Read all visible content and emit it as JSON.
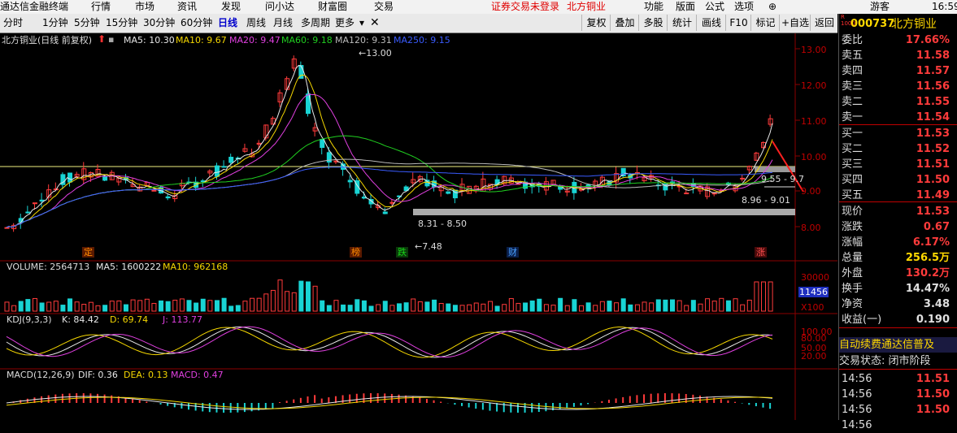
{
  "menu": {
    "app": "通达信金融终端",
    "items": [
      "行情",
      "市场",
      "资讯",
      "发现",
      "问小达",
      "财富圈",
      "交易"
    ],
    "notice": [
      "证券交易未登录",
      "北方铜业"
    ],
    "right": [
      "功能",
      "版面",
      "公式",
      "选项"
    ],
    "user": "游客",
    "time": "16:59"
  },
  "periods": [
    "分时",
    "1分钟",
    "5分钟",
    "15分钟",
    "30分钟",
    "60分钟",
    "日线",
    "周线",
    "月线",
    "多周期",
    "更多"
  ],
  "active_period": "日线",
  "tools": [
    "复权",
    "叠加",
    "多股",
    "统计",
    "画线",
    "F10",
    "标记",
    "+自选",
    "返回"
  ],
  "price_panel": {
    "title": "北方铜业(日线 前复权)",
    "ma": [
      {
        "label": "MA5: 10.30",
        "color": "#e8e8e8"
      },
      {
        "label": "MA10: 9.67",
        "color": "#f5d700"
      },
      {
        "label": "MA20: 9.47",
        "color": "#e040e0"
      },
      {
        "label": "MA60: 9.18",
        "color": "#20d020"
      },
      {
        "label": "MA120: 9.31",
        "color": "#bbbbbb"
      },
      {
        "label": "MA250: 9.15",
        "color": "#3a5cff"
      }
    ],
    "axis": [
      "13.00",
      "12.00",
      "11.00",
      "10.00",
      "9.00",
      "8.00"
    ],
    "annotations": {
      "high": "13.00",
      "low": "7.48",
      "zone_low": "8.31 - 8.50",
      "zone_mid": "8.96 - 9.01",
      "zone_top": "9.55 - 9.7"
    },
    "markers": [
      "定",
      "榜",
      "跌",
      "财",
      "涨"
    ]
  },
  "volume_panel": {
    "label": "VOLUME: 2564713",
    "ma5": "MA5: 1600222",
    "ma10": "MA10: 962168",
    "axis": [
      "30000",
      "20000",
      "10000"
    ],
    "readout": "11456",
    "unit": "X100"
  },
  "kdj_panel": {
    "label": "KDJ(9,3,3)",
    "k": "K: 84.42",
    "d": "D: 69.74",
    "j": "J: 113.77",
    "axis": [
      "100.00",
      "80.00",
      "50.00",
      "20.00"
    ]
  },
  "macd_panel": {
    "label": "MACD(12,26,9)",
    "dif": "DIF: 0.36",
    "dea": "DEA: 0.13",
    "macd": "MACD: 0.47"
  },
  "quote": {
    "code": "000737",
    "name": "北方铜业",
    "rows": [
      {
        "k": "委比",
        "v": "17.66%",
        "c": "red"
      },
      {
        "k": "卖五",
        "v": "11.58",
        "c": "red"
      },
      {
        "k": "卖四",
        "v": "11.57",
        "c": "red"
      },
      {
        "k": "卖三",
        "v": "11.56",
        "c": "red"
      },
      {
        "k": "卖二",
        "v": "11.55",
        "c": "red"
      },
      {
        "k": "卖一",
        "v": "11.54",
        "c": "red"
      },
      {
        "k": "买一",
        "v": "11.53",
        "c": "red"
      },
      {
        "k": "买二",
        "v": "11.52",
        "c": "red"
      },
      {
        "k": "买三",
        "v": "11.51",
        "c": "red"
      },
      {
        "k": "买四",
        "v": "11.50",
        "c": "red"
      },
      {
        "k": "买五",
        "v": "11.49",
        "c": "red"
      },
      {
        "k": "现价",
        "v": "11.53",
        "c": "red"
      },
      {
        "k": "涨跌",
        "v": "0.67",
        "c": "red"
      },
      {
        "k": "涨幅",
        "v": "6.17%",
        "c": "red"
      },
      {
        "k": "总量",
        "v": "256.5万",
        "c": "yellow"
      },
      {
        "k": "外盘",
        "v": "130.2万",
        "c": "red"
      },
      {
        "k": "换手",
        "v": "14.47%",
        "c": "white"
      },
      {
        "k": "净资",
        "v": "3.48",
        "c": "white"
      },
      {
        "k": "收益(一)",
        "v": "0.190",
        "c": "white"
      }
    ],
    "promo": "自动续费通达信普及",
    "status": "交易状态: 闭市阶段",
    "ticks": [
      {
        "t": "14:56",
        "p": "11.51"
      },
      {
        "t": "14:56",
        "p": "11.50"
      },
      {
        "t": "14:56",
        "p": "11.50"
      },
      {
        "t": "14:56",
        "p": ""
      }
    ]
  }
}
